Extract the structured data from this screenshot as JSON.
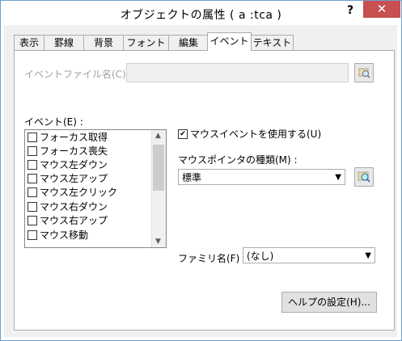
{
  "window": {
    "title": "オブジェクトの属性 ( a :tca )",
    "help_glyph": "?",
    "close_glyph": "✕"
  },
  "tabs": [
    {
      "label": "表示"
    },
    {
      "label": "罫線"
    },
    {
      "label": "背景"
    },
    {
      "label": "フォント"
    },
    {
      "label": "編集"
    },
    {
      "label": "イベント"
    },
    {
      "label": "テキスト"
    }
  ],
  "event_file": {
    "label": "イベントファイル名(C) :",
    "value": ""
  },
  "events": {
    "label": "イベント(E) :",
    "items": [
      {
        "label": "フォーカス取得",
        "checked": false
      },
      {
        "label": "フォーカス喪失",
        "checked": false
      },
      {
        "label": "マウス左ダウン",
        "checked": false
      },
      {
        "label": "マウス左アップ",
        "checked": false
      },
      {
        "label": "マウス左クリック",
        "checked": false
      },
      {
        "label": "マウス右ダウン",
        "checked": false
      },
      {
        "label": "マウス右アップ",
        "checked": false
      },
      {
        "label": "マウス移動",
        "checked": false
      }
    ]
  },
  "use_mouse_event": {
    "label": "マウスイベントを使用する(U)",
    "checked": true,
    "check_glyph": "✔"
  },
  "pointer_type": {
    "label": "マウスポインタの種類(M) :",
    "value": "標準"
  },
  "family": {
    "label": "ファミリ名(F) :",
    "value": "(なし)"
  },
  "help_button": {
    "label": "ヘルプの設定(H)..."
  },
  "colors": {
    "close_bg": "#c75050",
    "border": "#6f9fcf",
    "panel_bg": "#ffffff",
    "dialog_bg": "#f0f0f0"
  }
}
